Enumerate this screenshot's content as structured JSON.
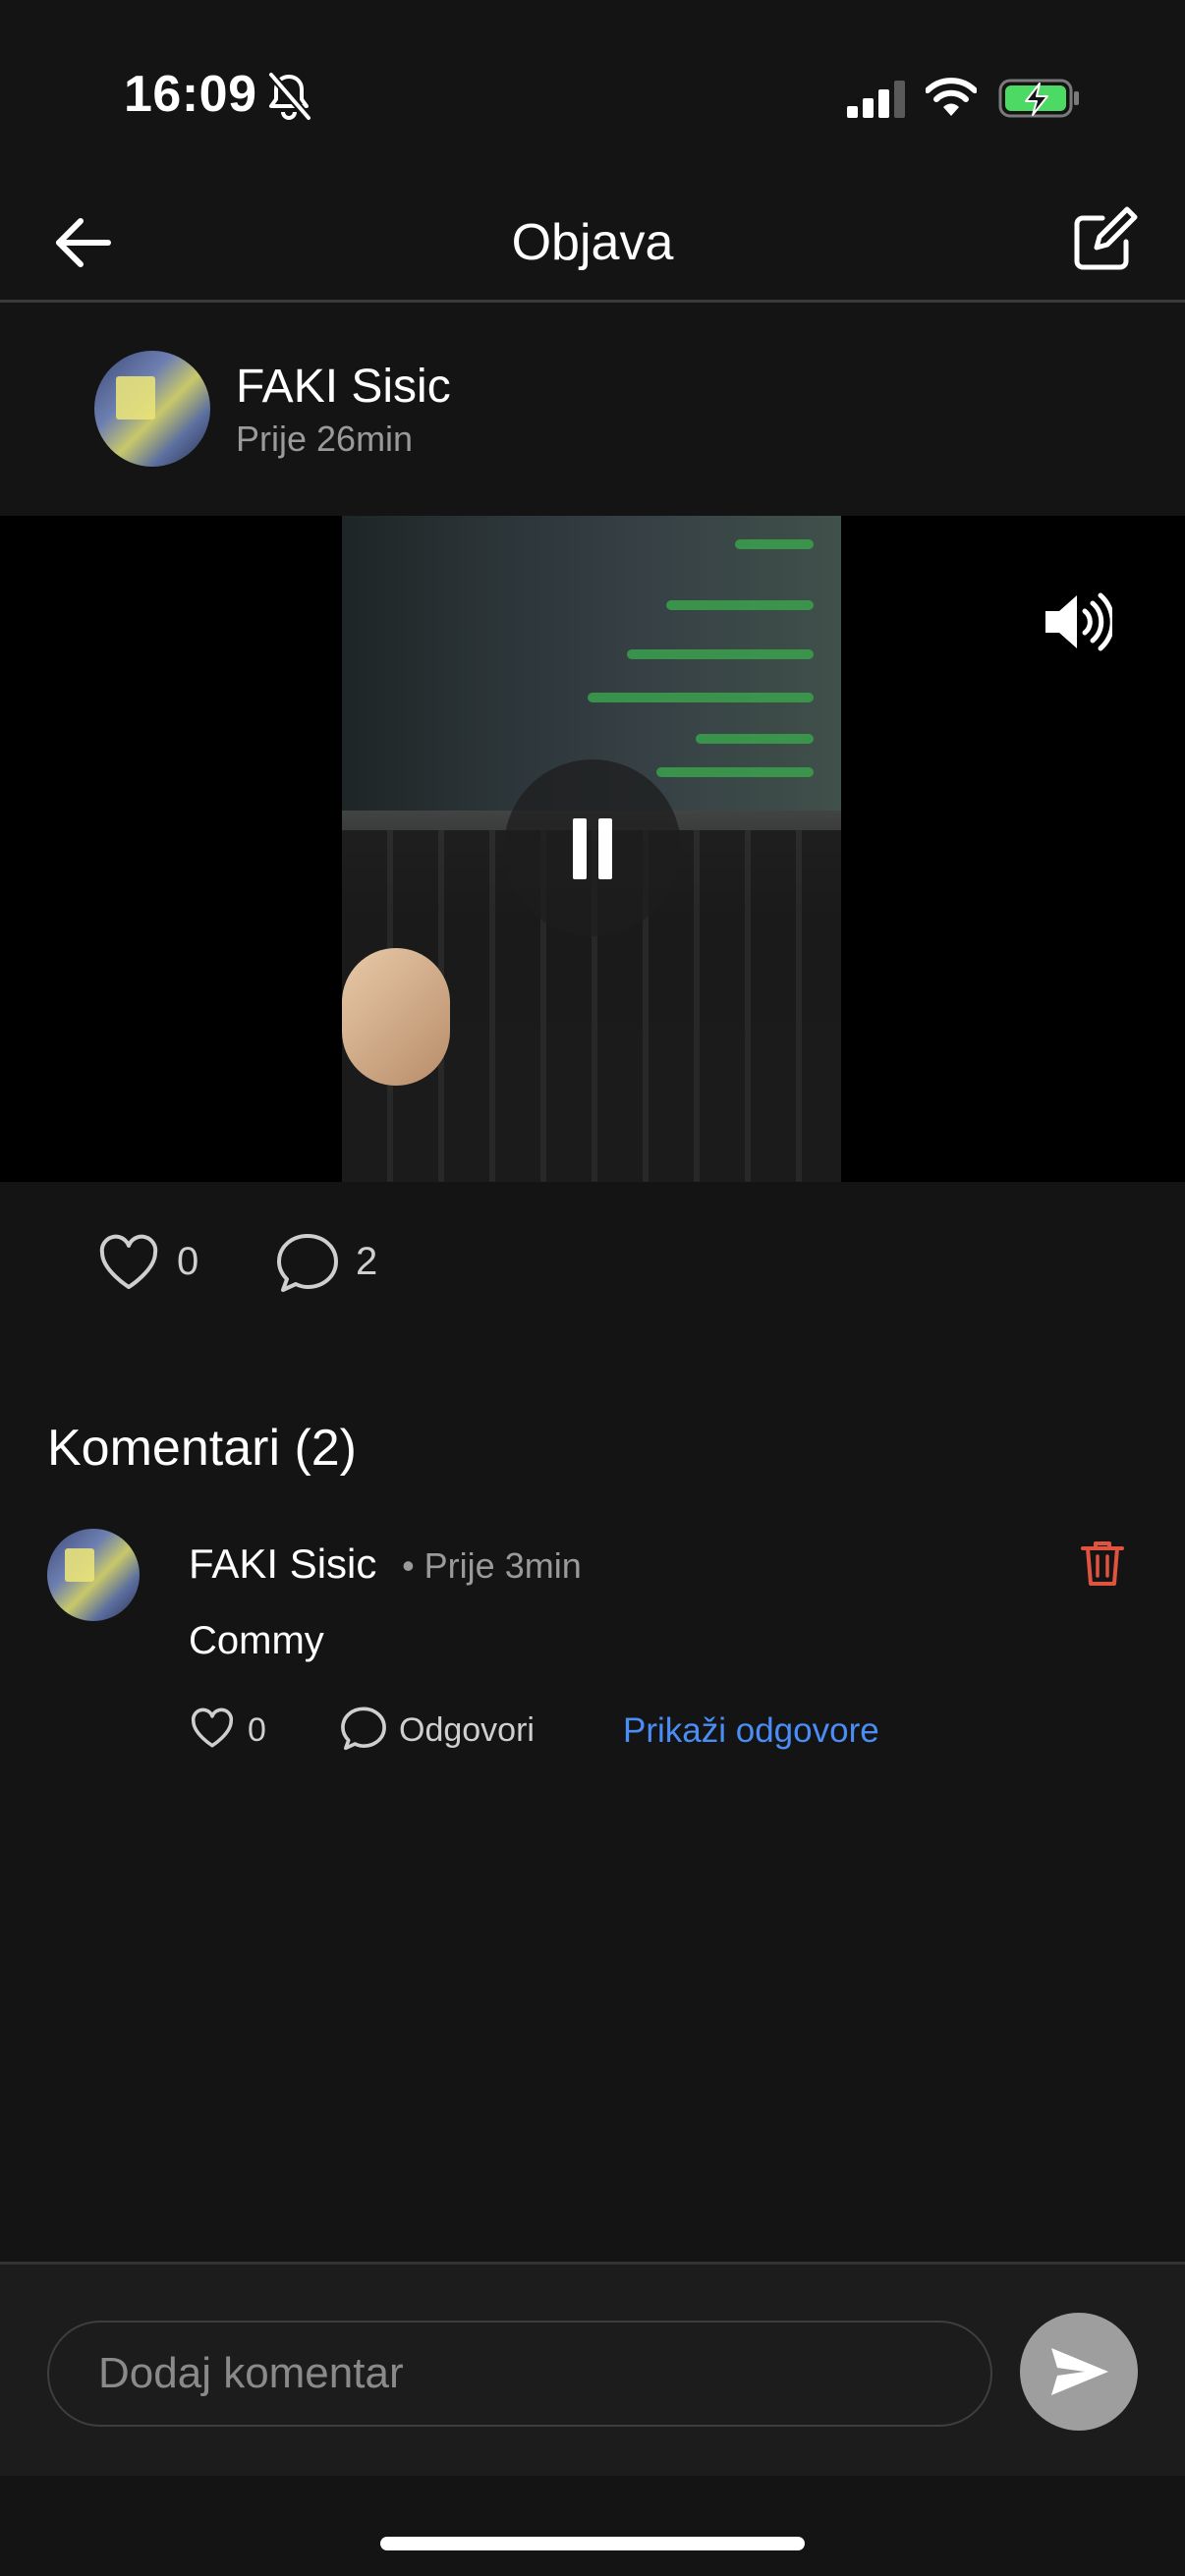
{
  "status_bar": {
    "time": "16:09"
  },
  "header": {
    "title": "Objava"
  },
  "post": {
    "author": "FAKI Sisic",
    "time": "Prije 26min",
    "likes": "0",
    "comments": "2"
  },
  "comments_section": {
    "heading": "Komentari (2)",
    "items": [
      {
        "author": "FAKI Sisic",
        "time": "• Prije 3min",
        "text": "Commy",
        "likes": "0",
        "reply_label": "Odgovori",
        "show_replies_label": "Prikaži odgovore"
      }
    ]
  },
  "composer": {
    "placeholder": "Dodaj komentar"
  },
  "colors": {
    "accent_link": "#4a8df6",
    "delete": "#e0533f",
    "battery": "#4cd964"
  },
  "icons": [
    "bell-slash-icon",
    "signal-icon",
    "wifi-icon",
    "battery-charging-icon",
    "back-arrow-icon",
    "edit-icon",
    "pause-icon",
    "volume-icon",
    "heart-icon",
    "comment-icon",
    "trash-icon",
    "send-icon"
  ]
}
